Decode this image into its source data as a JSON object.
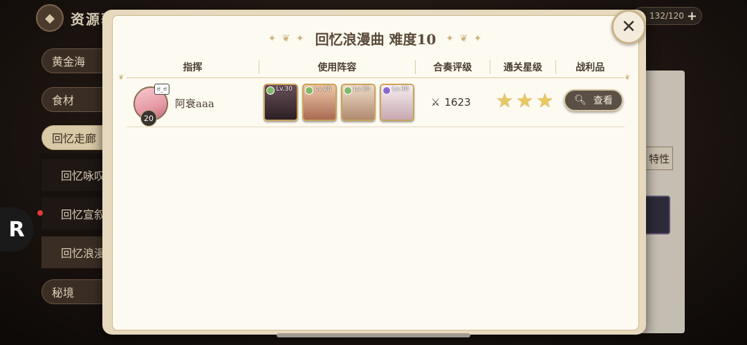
{
  "background": {
    "header_title": "资源获取",
    "resource": {
      "value": "132/120",
      "plus": "+"
    },
    "menu": [
      {
        "label": "黄金海",
        "active": false
      },
      {
        "label": "食材",
        "active": false
      },
      {
        "label": "回忆走廊",
        "active": true
      },
      {
        "label": "秘境",
        "active": false
      }
    ],
    "submenu": [
      {
        "label": "回忆咏叹",
        "active": false
      },
      {
        "label": "回忆宣叙",
        "active": false
      },
      {
        "label": "回忆浪漫",
        "active": true
      }
    ],
    "right_tag": "特性",
    "r_badge": "R"
  },
  "modal": {
    "title": "回忆浪漫曲 难度10",
    "close_icon": "close-icon",
    "columns": [
      "指挥",
      "使用阵容",
      "合奏评级",
      "通关星级",
      "战利品"
    ],
    "rows": [
      {
        "player_name": "阿衰aaa",
        "player_level": "20",
        "avatar_badge": "ಠ_ಠ",
        "lineup": [
          {
            "level": "Lv.30",
            "attr_color": "#7fb86a",
            "bg_top": "#6a4f5a",
            "bg_bottom": "#2a1f22"
          },
          {
            "level": "Lv.20",
            "attr_color": "#7fb86a",
            "bg_top": "#f0c8a8",
            "bg_bottom": "#a86a52"
          },
          {
            "level": "Lv.30",
            "attr_color": "#7fb86a",
            "bg_top": "#f0dcc8",
            "bg_bottom": "#b08a70"
          },
          {
            "level": "Lv.30",
            "attr_color": "#8a6ad0",
            "bg_top": "#f6eef0",
            "bg_bottom": "#c8a8b0"
          }
        ],
        "power": "1623",
        "stars": 3,
        "view_label": "查看"
      }
    ]
  }
}
